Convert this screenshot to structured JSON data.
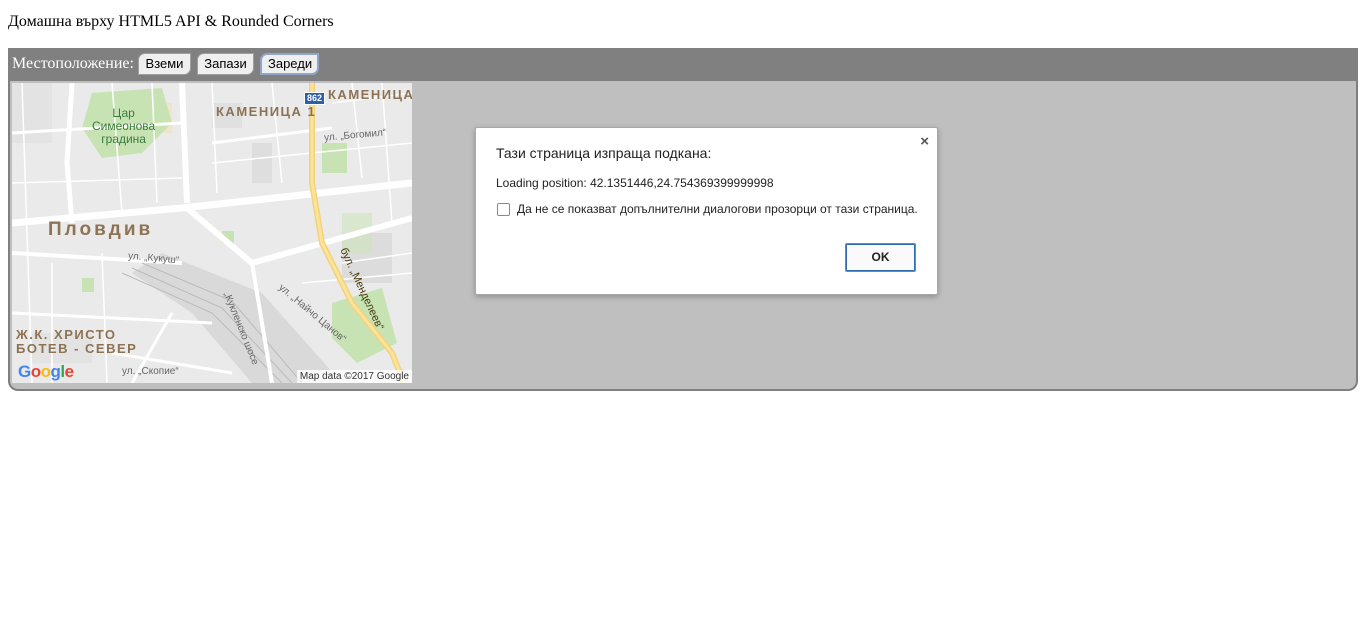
{
  "page": {
    "title": "Домашна върху HTML5 API & Rounded Corners"
  },
  "toolbar": {
    "label": "Местоположение:",
    "buttons": [
      {
        "label": "Вземи"
      },
      {
        "label": "Запази"
      },
      {
        "label": "Зареди"
      }
    ]
  },
  "map": {
    "labels": {
      "park": "Цар\nСимеонова\nградина",
      "district_kamenitsa_top": "КАМЕНИЦА",
      "district_kamenitsa_1": "КАМЕНИЦА 1",
      "city": "Пловдив",
      "district_hristo_botev": "Ж.К. ХРИСТО\nБОТЕВ - СЕВЕР",
      "street_bogomil": "ул. „Богомил“",
      "street_kukush": "ул. „Кукуш“",
      "street_naycho_tsanov": "ул. „Найчо Цанов“",
      "street_kuklensko": "„Кукленско шосе",
      "street_skopie": "ул. „Скопие“",
      "blvd_mendeleev": "бул. „Менделеев“"
    },
    "road_number": "862",
    "logo": "Google",
    "attribution": "Map data ©2017 Google"
  },
  "dialog": {
    "title": "Тази страница изпраща подкана:",
    "message": "Loading position: 42.1351446,24.754369399999998",
    "checkbox_label": "Да не се показват допълнителни диалогови прозорци от тази страница.",
    "ok_label": "OK",
    "close_symbol": "×"
  },
  "colors": {
    "toolbar_bg": "#808080",
    "content_bg": "#bfbfbf",
    "dialog_ok_border": "#4d90d4"
  }
}
